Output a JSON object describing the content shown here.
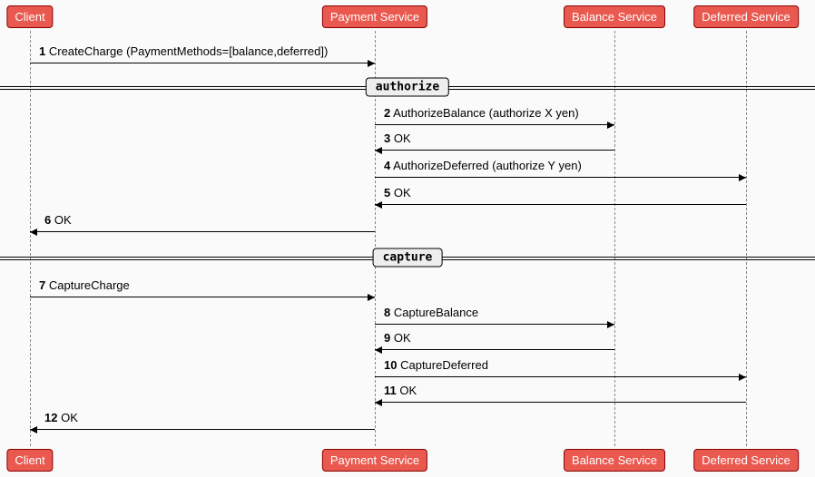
{
  "participants": {
    "client": "Client",
    "payment": "Payment Service",
    "balance": "Balance Service",
    "deferred": "Deferred Service"
  },
  "dividers": {
    "authorize": "authorize",
    "capture": "capture"
  },
  "messages": {
    "m1": {
      "n": "1",
      "text": "CreateCharge (PaymentMethods=[balance,deferred])"
    },
    "m2": {
      "n": "2",
      "text": "AuthorizeBalance (authorize X yen)"
    },
    "m3": {
      "n": "3",
      "text": "OK"
    },
    "m4": {
      "n": "4",
      "text": "AuthorizeDeferred (authorize Y yen)"
    },
    "m5": {
      "n": "5",
      "text": "OK"
    },
    "m6": {
      "n": "6",
      "text": "OK"
    },
    "m7": {
      "n": "7",
      "text": "CaptureCharge"
    },
    "m8": {
      "n": "8",
      "text": "CaptureBalance"
    },
    "m9": {
      "n": "9",
      "text": "OK"
    },
    "m10": {
      "n": "10",
      "text": "CaptureDeferred"
    },
    "m11": {
      "n": "11",
      "text": "OK"
    },
    "m12": {
      "n": "12",
      "text": "OK"
    }
  }
}
